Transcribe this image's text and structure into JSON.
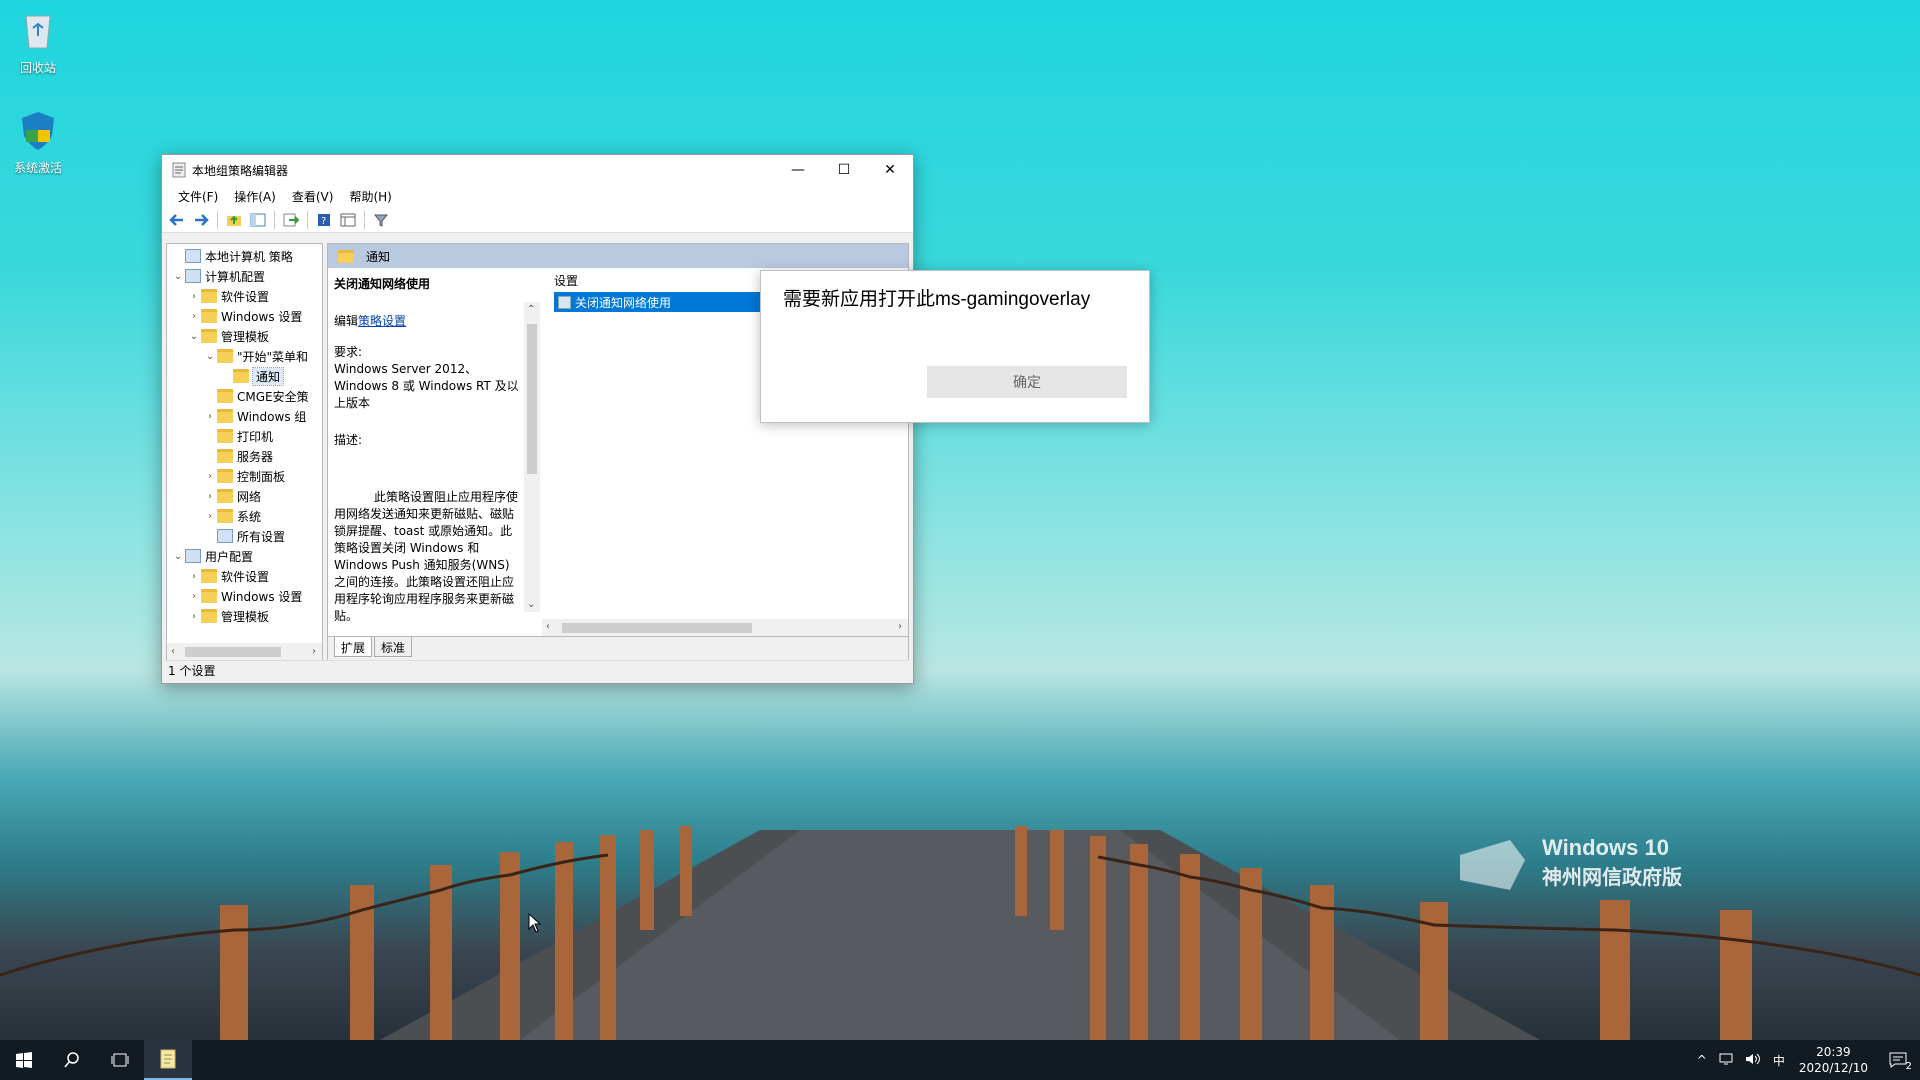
{
  "desktop": {
    "icons": [
      {
        "label": "回收站",
        "icon": "recycle-bin-icon"
      },
      {
        "label": "系统激活",
        "icon": "activation-shield-icon"
      }
    ],
    "watermark": {
      "line1": "Windows 10",
      "line2": "神州网信政府版"
    }
  },
  "window": {
    "title": "本地组策略编辑器",
    "controls": {
      "minimize": "—",
      "maximize": "☐",
      "close": "✕"
    },
    "menu": [
      "文件(F)",
      "操作(A)",
      "查看(V)",
      "帮助(H)"
    ],
    "toolbar": [
      "back-arrow-icon",
      "forward-arrow-icon",
      "up-folder-icon",
      "show-hide-tree-icon",
      "export-list-icon",
      "help-icon",
      "properties-icon",
      "filter-icon"
    ],
    "tree": [
      {
        "label": "本地计算机 策略",
        "level": 0,
        "expander": "",
        "icon": "policy-icon"
      },
      {
        "label": "计算机配置",
        "level": 0,
        "expander": "⌄",
        "icon": "computer-icon"
      },
      {
        "label": "软件设置",
        "level": 1,
        "expander": "›",
        "icon": "folder-icon"
      },
      {
        "label": "Windows 设置",
        "level": 1,
        "expander": "›",
        "icon": "folder-icon"
      },
      {
        "label": "管理模板",
        "level": 1,
        "expander": "⌄",
        "icon": "folder-icon"
      },
      {
        "label": "\"开始\"菜单和",
        "level": 2,
        "expander": "⌄",
        "icon": "folder-icon"
      },
      {
        "label": "通知",
        "level": 3,
        "expander": "",
        "icon": "folder-icon",
        "selected": true
      },
      {
        "label": "CMGE安全策",
        "level": 2,
        "expander": "",
        "icon": "folder-icon"
      },
      {
        "label": "Windows 组",
        "level": 2,
        "expander": "›",
        "icon": "folder-icon"
      },
      {
        "label": "打印机",
        "level": 2,
        "expander": "",
        "icon": "folder-icon"
      },
      {
        "label": "服务器",
        "level": 2,
        "expander": "",
        "icon": "folder-icon"
      },
      {
        "label": "控制面板",
        "level": 2,
        "expander": "›",
        "icon": "folder-icon"
      },
      {
        "label": "网络",
        "level": 2,
        "expander": "›",
        "icon": "folder-icon"
      },
      {
        "label": "系统",
        "level": 2,
        "expander": "›",
        "icon": "folder-icon"
      },
      {
        "label": "所有设置",
        "level": 2,
        "expander": "",
        "icon": "settings-page-icon"
      },
      {
        "label": "用户配置",
        "level": 0,
        "expander": "⌄",
        "icon": "user-icon"
      },
      {
        "label": "软件设置",
        "level": 1,
        "expander": "›",
        "icon": "folder-icon"
      },
      {
        "label": "Windows 设置",
        "level": 1,
        "expander": "›",
        "icon": "folder-icon"
      },
      {
        "label": "管理模板",
        "level": 1,
        "expander": "›",
        "icon": "folder-icon"
      }
    ],
    "right_header": "通知",
    "description": {
      "heading": "关闭通知网络使用",
      "edit_prefix": "编辑",
      "edit_link": "策略设置",
      "requirements_label": "要求:",
      "requirements_text": "Windows Server 2012、Windows 8 或 Windows RT 及以上版本",
      "desc_label": "描述:",
      "desc_text": "此策略设置阻止应用程序使用网络发送通知来更新磁贴、磁贴锁屏提醒、toast 或原始通知。此策略设置关闭 Windows 和 Windows Push 通知服务(WNS)之间的连接。此策略设置还阻止应用程序轮询应用程序服务来更新磁贴。"
    },
    "list": {
      "column": "设置",
      "rows": [
        "关闭通知网络使用"
      ]
    },
    "tabs": [
      "扩展",
      "标准"
    ],
    "status": "1 个设置"
  },
  "dialog": {
    "message": "需要新应用打开此ms-gamingoverlay",
    "ok_label": "确定"
  },
  "taskbar": {
    "items": [
      "start-icon",
      "search-icon",
      "task-view-icon",
      "group-policy-app-icon"
    ],
    "tray": {
      "icons": [
        "chevron-up-icon",
        "network-icon",
        "volume-icon"
      ],
      "ime": "中",
      "time": "20:39",
      "date": "2020/12/10",
      "notifications": "2"
    }
  }
}
